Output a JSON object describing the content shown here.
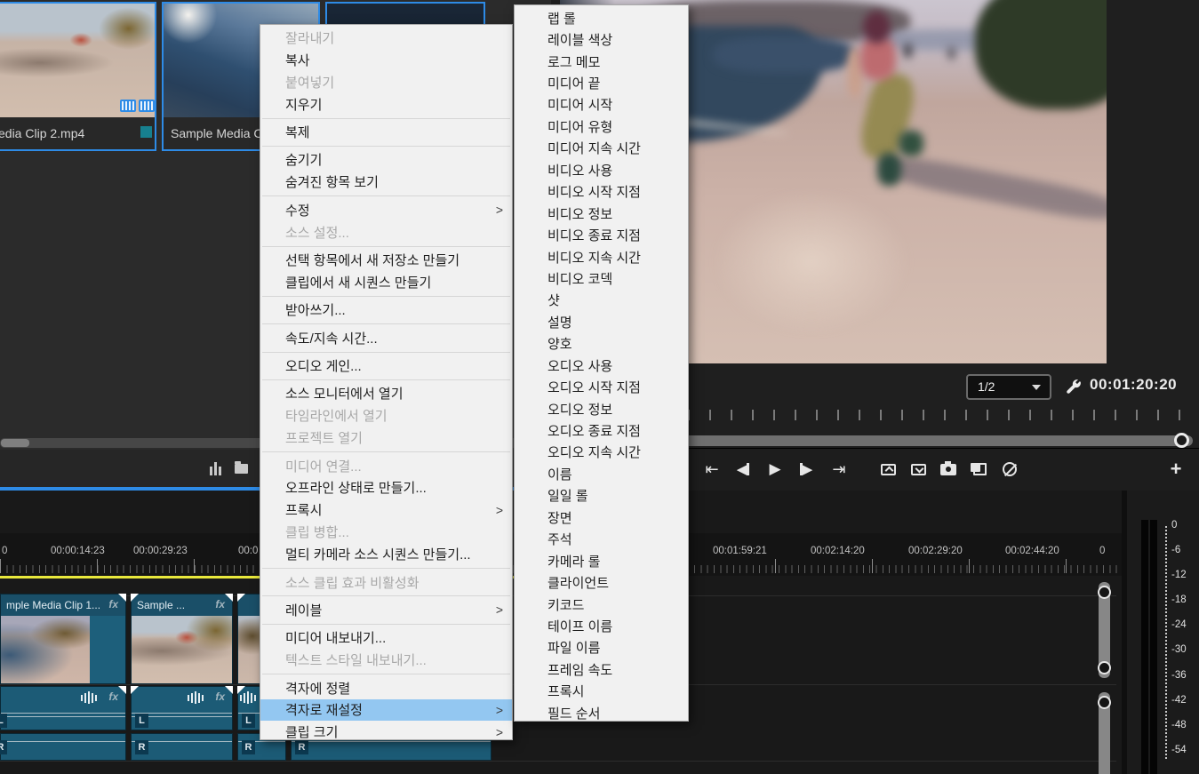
{
  "colors": {
    "accent_blue": "#2e8be6",
    "menu_highlight": "#93c7f1",
    "clip_teal": "#1d5f7b",
    "work_bar_yellow": "#e8e83c"
  },
  "ui": {
    "submenu_arrow": ">"
  },
  "project_panel": {
    "cards": {
      "card1_label": "edia Clip 2.mp4",
      "card2_label": "Sample Media Cl"
    }
  },
  "monitor": {
    "page_indicator": "1/2",
    "timecode": "00:01:20:20",
    "icons": {
      "go_to_in": "⇤",
      "step_back": "◀",
      "play": "▶",
      "step_forward": "▶",
      "go_to_out": "⇥",
      "add": "+"
    }
  },
  "timeline": {
    "ruler": {
      "l0": "0",
      "l1": "00:00:14:23",
      "l2": "00:00:29:23",
      "l3": "00:0",
      "r1": "00:01:59:21",
      "r2": "00:02:14:20",
      "r3": "00:02:29:20",
      "r4": "00:02:44:20",
      "r5": "0"
    },
    "fx_label": "fx",
    "video_clips": {
      "c1_title": "mple Media Clip 1...",
      "c2_title": "Sample ..."
    },
    "audio": {
      "left_channel": "L",
      "right_channel": "R"
    }
  },
  "audio_meter": {
    "scale": [
      "0",
      "-6",
      "-12",
      "-18",
      "-24",
      "-30",
      "-36",
      "-42",
      "-48",
      "-54"
    ]
  },
  "context_menu": {
    "items": [
      {
        "label": "잘라내기",
        "disabled": true
      },
      {
        "label": "복사"
      },
      {
        "label": "붙여넣기",
        "disabled": true
      },
      {
        "label": "지우기"
      },
      {
        "separator": true
      },
      {
        "label": "복제"
      },
      {
        "separator": true
      },
      {
        "label": "숨기기"
      },
      {
        "label": "숨겨진 항목 보기"
      },
      {
        "separator": true
      },
      {
        "label": "수정",
        "submenu": true
      },
      {
        "label": "소스 설정...",
        "disabled": true
      },
      {
        "separator": true
      },
      {
        "label": "선택 항목에서 새 저장소 만들기"
      },
      {
        "label": "클립에서 새 시퀀스 만들기"
      },
      {
        "separator": true
      },
      {
        "label": "받아쓰기..."
      },
      {
        "separator": true
      },
      {
        "label": "속도/지속 시간..."
      },
      {
        "separator": true
      },
      {
        "label": "오디오 게인..."
      },
      {
        "separator": true
      },
      {
        "label": "소스 모니터에서 열기"
      },
      {
        "label": "타임라인에서 열기",
        "disabled": true
      },
      {
        "label": "프로젝트 열기",
        "disabled": true
      },
      {
        "separator": true
      },
      {
        "label": "미디어 연결...",
        "disabled": true
      },
      {
        "label": "오프라인 상태로 만들기..."
      },
      {
        "label": "프록시",
        "submenu": true
      },
      {
        "label": "클립 병합...",
        "disabled": true
      },
      {
        "label": "멀티 카메라 소스 시퀀스 만들기..."
      },
      {
        "separator": true
      },
      {
        "label": "소스 클립 효과 비활성화",
        "disabled": true
      },
      {
        "separator": true
      },
      {
        "label": "레이블",
        "submenu": true
      },
      {
        "separator": true
      },
      {
        "label": "미디어 내보내기..."
      },
      {
        "label": "텍스트 스타일 내보내기...",
        "disabled": true
      },
      {
        "separator": true
      },
      {
        "label": "격자에 정렬"
      },
      {
        "label": "격자로 재설정",
        "submenu": true,
        "highlighted": true
      },
      {
        "label": "클립 크기",
        "submenu": true
      }
    ]
  },
  "field_submenu": {
    "items": [
      {
        "label": "랩 롤"
      },
      {
        "label": "레이블 색상"
      },
      {
        "label": "로그 메모"
      },
      {
        "label": "미디어 끝"
      },
      {
        "label": "미디어 시작"
      },
      {
        "label": "미디어 유형"
      },
      {
        "label": "미디어 지속 시간"
      },
      {
        "label": "비디오 사용"
      },
      {
        "label": "비디오 시작 지점"
      },
      {
        "label": "비디오 정보"
      },
      {
        "label": "비디오 종료 지점"
      },
      {
        "label": "비디오 지속 시간"
      },
      {
        "label": "비디오 코덱"
      },
      {
        "label": "샷"
      },
      {
        "label": "설명"
      },
      {
        "label": "양호"
      },
      {
        "label": "오디오 사용"
      },
      {
        "label": "오디오 시작 지점"
      },
      {
        "label": "오디오 정보"
      },
      {
        "label": "오디오 종료 지점"
      },
      {
        "label": "오디오 지속 시간"
      },
      {
        "label": "이름"
      },
      {
        "label": "일일 롤"
      },
      {
        "label": "장면"
      },
      {
        "label": "주석"
      },
      {
        "label": "카메라 롤"
      },
      {
        "label": "클라이언트"
      },
      {
        "label": "키코드"
      },
      {
        "label": "테이프 이름"
      },
      {
        "label": "파일 이름"
      },
      {
        "label": "프레임 속도"
      },
      {
        "label": "프록시"
      },
      {
        "label": "필드 순서"
      }
    ]
  }
}
